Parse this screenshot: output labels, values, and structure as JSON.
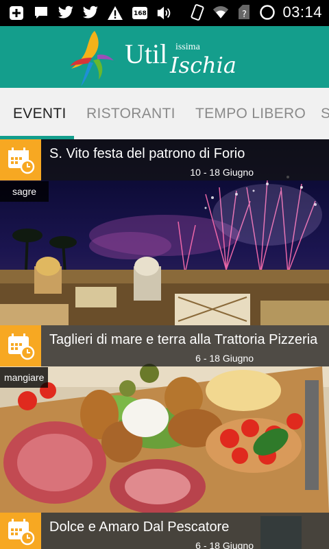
{
  "status_bar": {
    "time": "03:14",
    "notification_icons": [
      "add-icon",
      "message-icon",
      "twitter-icon",
      "twitter-icon",
      "warning-icon",
      "badge-168-icon",
      "cast-icon"
    ],
    "badge_number": "168",
    "system_icons": [
      "vibrate-icon",
      "wifi-icon",
      "no-sim-icon",
      "sync-icon"
    ]
  },
  "header": {
    "logo_text_main": "Util",
    "logo_text_sup": "issima",
    "logo_text_script": "Ischia",
    "colors": {
      "teal": "#149e8c",
      "accent_orange": "#f7a822"
    }
  },
  "tabs": {
    "items": [
      {
        "label": "EVENTI",
        "active": true
      },
      {
        "label": "RISTORANTI",
        "active": false
      },
      {
        "label": "TEMPO LIBERO",
        "active": false
      },
      {
        "label": "S",
        "active": false
      }
    ]
  },
  "events": [
    {
      "title": "S. Vito festa del patrono di Forio",
      "date": "10 - 18 Giugno",
      "category": "sagre",
      "image": "fireworks-over-town"
    },
    {
      "title": "Taglieri di mare e terra alla Trattoria Pizzeria",
      "date": "6 - 18 Giugno",
      "category": "mangiare",
      "image": "food-platter"
    },
    {
      "title": "Dolce e Amaro Dal Pescatore",
      "date": "6 - 18 Giugno",
      "category": "",
      "image": "restaurant"
    }
  ]
}
